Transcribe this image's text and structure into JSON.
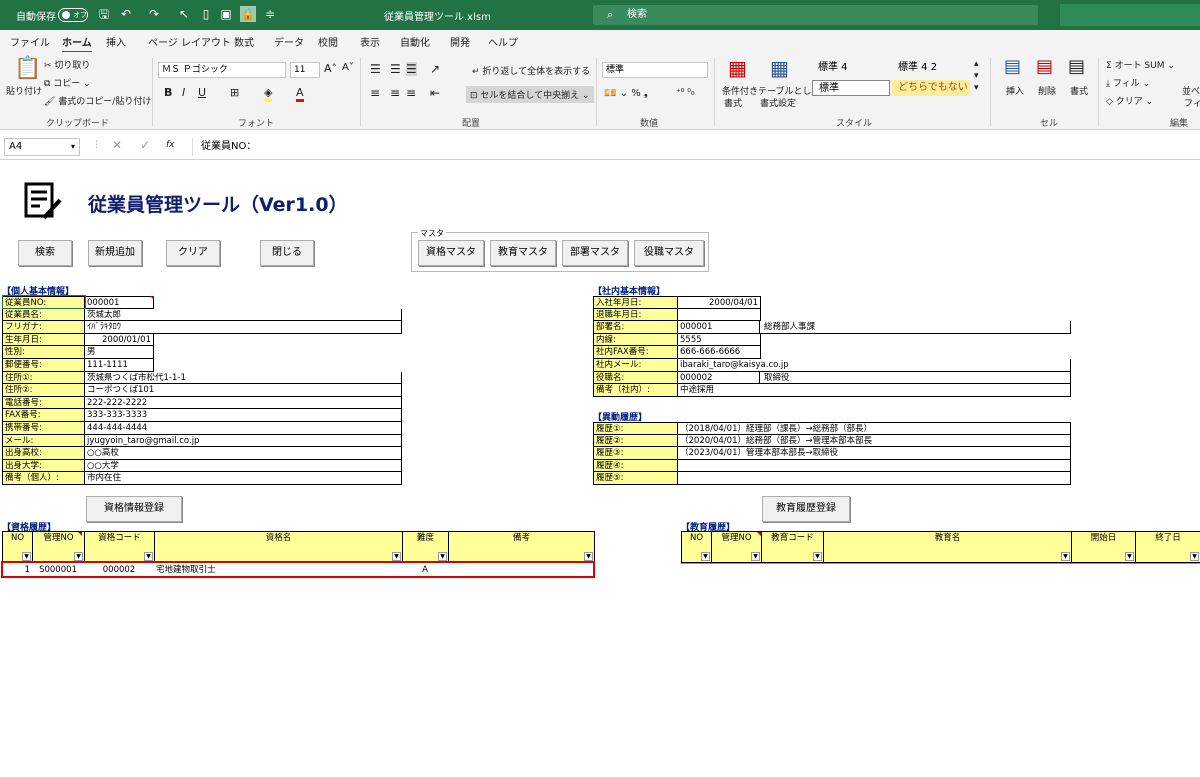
{
  "titlebar": {
    "autosave_label": "自動保存",
    "autosave_state": "オフ",
    "filename": "従業員管理ツール.xlsm",
    "search_placeholder": "検索"
  },
  "tabs": [
    "ファイル",
    "ホーム",
    "挿入",
    "ページ レイアウト",
    "数式",
    "データ",
    "校閲",
    "表示",
    "自動化",
    "開発",
    "ヘルプ"
  ],
  "active_tab": "ホーム",
  "ribbon": {
    "clipboard": {
      "paste": "貼り付け",
      "cut": "切り取り",
      "copy": "コピー",
      "format_painter": "書式のコピー/貼り付け",
      "group": "クリップボード"
    },
    "font": {
      "name": "ＭＳ Ｐゴシック",
      "size": "11",
      "bold": "B",
      "italic": "I",
      "underline": "U",
      "group": "フォント"
    },
    "alignment": {
      "wrap": "折り返して全体を表示する",
      "merge": "セルを結合して中央揃え",
      "group": "配置"
    },
    "number": {
      "format": "標準",
      "group": "数値"
    },
    "styles": {
      "conditional": "条件付き",
      "conditional2": "書式",
      "table": "テーブルとして",
      "table2": "書式設定",
      "s1": "標準 4",
      "s2": "標準 4 2",
      "s3": "標準",
      "s4": "どちらでもない",
      "group": "スタイル"
    },
    "cells": {
      "insert": "挿入",
      "delete": "削除",
      "format": "書式",
      "group": "セル"
    },
    "editing": {
      "autosum": "オート SUM",
      "fill": "フィル",
      "clear": "クリア",
      "sort": "並べ",
      "sort2": "フィ",
      "group": "編集"
    }
  },
  "formula_bar": {
    "namebox": "A4",
    "fx": "fx",
    "content": "従業員NO："
  },
  "sheet": {
    "title": "従業員管理ツール（Ver1.0）",
    "buttons": {
      "search": "検索",
      "new": "新規追加",
      "clear": "クリア",
      "close": "閉じる"
    },
    "master": {
      "label": "マスタ",
      "qual": "資格マスタ",
      "edu": "教育マスタ",
      "dept": "部署マスタ",
      "role": "役職マスタ"
    },
    "personal": {
      "section": "【個人基本情報】",
      "rows": [
        {
          "label": "従業員NO:",
          "value": "000001"
        },
        {
          "label": "従業員名:",
          "value": "茨城太郎"
        },
        {
          "label": "フリガナ:",
          "value": "ｲﾊﾞﾗｷﾀﾛｳ"
        },
        {
          "label": "生年月日:",
          "value": "2000/01/01"
        },
        {
          "label": "性別:",
          "value": "男"
        },
        {
          "label": "郵便番号:",
          "value": "111-1111"
        },
        {
          "label": "住所①:",
          "value": "茨城県つくば市松代1-1-1"
        },
        {
          "label": "住所②:",
          "value": "コーポつくば101"
        },
        {
          "label": "電話番号:",
          "value": "222-222-2222"
        },
        {
          "label": "FAX番号:",
          "value": "333-333-3333"
        },
        {
          "label": "携帯番号:",
          "value": "444-444-4444"
        },
        {
          "label": "メール:",
          "value": "jyugyoin_taro@gmail.co.jp"
        },
        {
          "label": "出身高校:",
          "value": "○○高校"
        },
        {
          "label": "出身大学:",
          "value": "○○大学"
        },
        {
          "label": "備考（個人）:",
          "value": "市内在住"
        }
      ]
    },
    "company": {
      "section": "【社内基本情報】",
      "rows": [
        {
          "label": "入社年月日:",
          "value": "2000/04/01",
          "value2": ""
        },
        {
          "label": "退職年月日:",
          "value": "",
          "value2": ""
        },
        {
          "label": "部署名:",
          "value": "000001",
          "value2": "総務部人事課"
        },
        {
          "label": "内線:",
          "value": "5555",
          "value2": ""
        },
        {
          "label": "社内FAX番号:",
          "value": "666-666-6666",
          "value2": ""
        },
        {
          "label": "社内メール:",
          "value": "ibaraki_taro@kaisya.co.jp",
          "value2": ""
        },
        {
          "label": "役職名:",
          "value": "000002",
          "value2": "取締役"
        },
        {
          "label": "備考（社内）:",
          "value": "中途採用",
          "value2": ""
        }
      ]
    },
    "transfer": {
      "section": "【異動履歴】",
      "rows": [
        {
          "label": "履歴①:",
          "value": "（2018/04/01）経理部（課長）→総務部（部長）"
        },
        {
          "label": "履歴②:",
          "value": "（2020/04/01）総務部（部長）→管理本部本部長"
        },
        {
          "label": "履歴③:",
          "value": "（2023/04/01）管理本部本部長→取締役"
        },
        {
          "label": "履歴④:",
          "value": ""
        },
        {
          "label": "履歴⑤:",
          "value": ""
        }
      ]
    },
    "qual_reg_button": "資格情報登録",
    "edu_reg_button": "教育履歴登録",
    "qual_history": {
      "section": "【資格履歴】",
      "headers": [
        "NO",
        "管理NO",
        "資格コード",
        "資格名",
        "難度",
        "備考"
      ],
      "rows": [
        [
          "1",
          "S000001",
          "000002",
          "宅地建物取引士",
          "A",
          ""
        ]
      ]
    },
    "edu_history": {
      "section": "【教育履歴】",
      "headers": [
        "NO",
        "管理NO",
        "教育コード",
        "教育名",
        "開始日",
        "終了日"
      ]
    }
  }
}
